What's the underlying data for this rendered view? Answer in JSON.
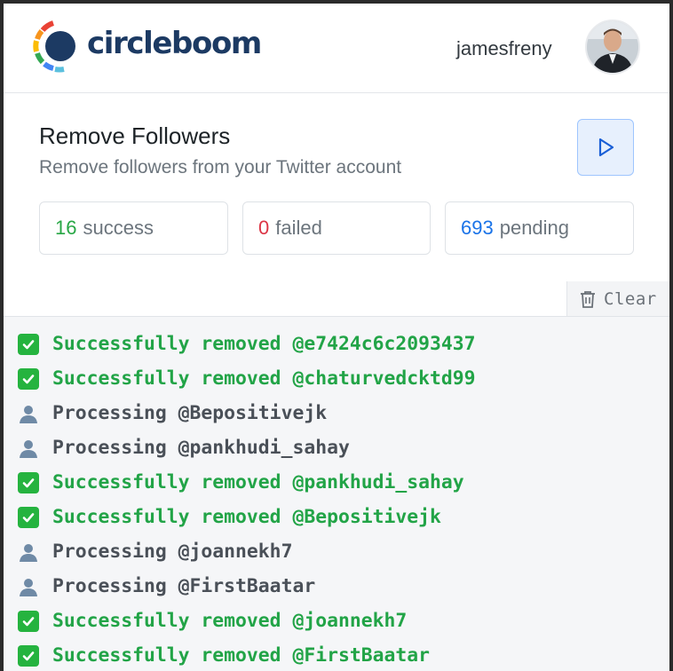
{
  "app": {
    "brand": "circleboom"
  },
  "header": {
    "username": "jamesfreny"
  },
  "task": {
    "title": "Remove Followers",
    "subtitle": "Remove followers from your Twitter account",
    "run_icon": "play-icon"
  },
  "stats": {
    "success": {
      "count": "16",
      "label": "success",
      "color": "#28a745"
    },
    "failed": {
      "count": "0",
      "label": "failed",
      "color": "#dc3545"
    },
    "pending": {
      "count": "693",
      "label": "pending",
      "color": "#1a73e8"
    }
  },
  "log_panel": {
    "clear_label": "Clear",
    "clear_icon": "trash-icon",
    "lines": [
      {
        "type": "success",
        "icon": "check-icon",
        "text": "Successfully removed @e7424c6c2093437"
      },
      {
        "type": "success",
        "icon": "check-icon",
        "text": "Successfully removed @chaturvedcktd99"
      },
      {
        "type": "processing",
        "icon": "user-icon",
        "text": "Processing @Bepositivejk"
      },
      {
        "type": "processing",
        "icon": "user-icon",
        "text": "Processing @pankhudi_sahay"
      },
      {
        "type": "success",
        "icon": "check-icon",
        "text": "Successfully removed @pankhudi_sahay"
      },
      {
        "type": "success",
        "icon": "check-icon",
        "text": "Successfully removed @Bepositivejk"
      },
      {
        "type": "processing",
        "icon": "user-icon",
        "text": "Processing @joannekh7"
      },
      {
        "type": "processing",
        "icon": "user-icon",
        "text": "Processing @FirstBaatar"
      },
      {
        "type": "success",
        "icon": "check-icon",
        "text": "Successfully removed @joannekh7"
      },
      {
        "type": "success",
        "icon": "check-icon",
        "text": "Successfully removed @FirstBaatar"
      }
    ]
  }
}
